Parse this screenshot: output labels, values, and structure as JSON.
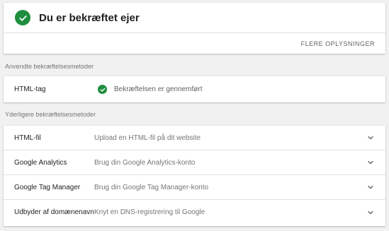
{
  "owner": {
    "title": "Du er bekræftet ejer",
    "more_label": "FLERE OPLYSNINGER"
  },
  "applied": {
    "section_label": "Anvendte bekræftelsesmetoder",
    "method": "HTML-tag",
    "status": "Bekræftelsen er gennemført"
  },
  "more_methods": {
    "section_label": "Yderligere bekræftelsesmetoder",
    "items": [
      {
        "name": "HTML-fil",
        "description": "Upload en HTML-fil på dit website"
      },
      {
        "name": "Google Analytics",
        "description": "Brug din Google Analytics-konto"
      },
      {
        "name": "Google Tag Manager",
        "description": "Brug din Google Tag Manager-konto"
      },
      {
        "name": "Udbyder af domænenavn",
        "description": "Knyt en DNS-registrering til Google"
      }
    ]
  },
  "colors": {
    "success": "#1e8e3e",
    "background": "#f1f1f1",
    "card": "#ffffff"
  },
  "icons": {
    "verified": "check-circle-icon",
    "expand": "chevron-down-icon"
  }
}
